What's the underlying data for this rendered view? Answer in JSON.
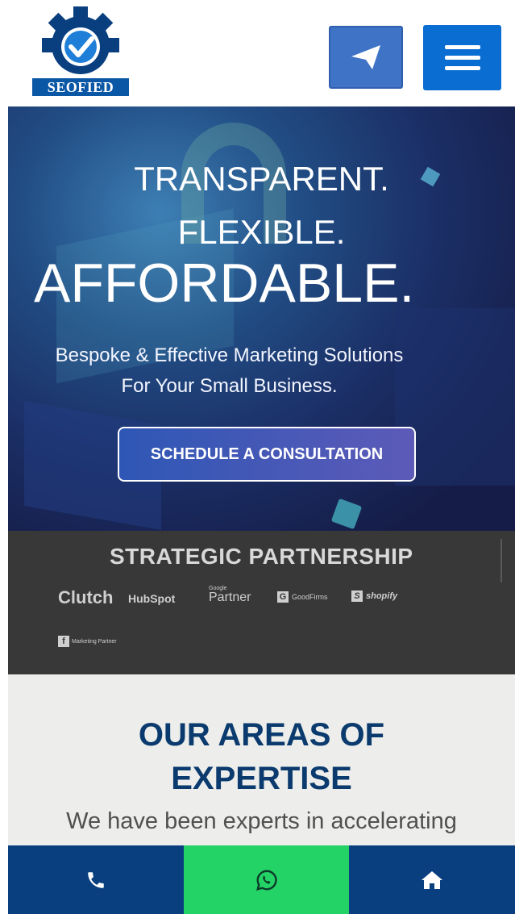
{
  "header": {
    "logo_text": "SEOFIED",
    "send_icon": "paper-plane-icon",
    "menu_icon": "hamburger-menu-icon"
  },
  "hero": {
    "line1": "TRANSPARENT.",
    "line2": "FLEXIBLE.",
    "line3": "AFFORDABLE.",
    "sub1": "Bespoke & Effective Marketing Solutions",
    "sub2": "For Your Small Business.",
    "cta": "SCHEDULE A CONSULTATION"
  },
  "partners": {
    "title": "STRATEGIC PARTNERSHIP",
    "logos": {
      "clutch": "Clutch",
      "hubspot": "HubSpot",
      "google_small": "Google",
      "google_partner": "Partner",
      "goodfirms": "GoodFirms",
      "shopify": "shopify",
      "facebook": "Marketing Partner"
    }
  },
  "expertise": {
    "title_line1": "OUR AREAS OF",
    "title_line2": "EXPERTISE",
    "text": "We have been experts in accelerating"
  },
  "bottom_bar": {
    "phone_icon": "phone-icon",
    "whatsapp_icon": "whatsapp-icon",
    "home_icon": "home-icon"
  },
  "colors": {
    "brand_blue": "#0a57a6",
    "menu_blue": "#0a6dd1",
    "heading_navy": "#0b3b6e",
    "whatsapp_green": "#23d366",
    "bar_navy": "#0a3f7f"
  }
}
